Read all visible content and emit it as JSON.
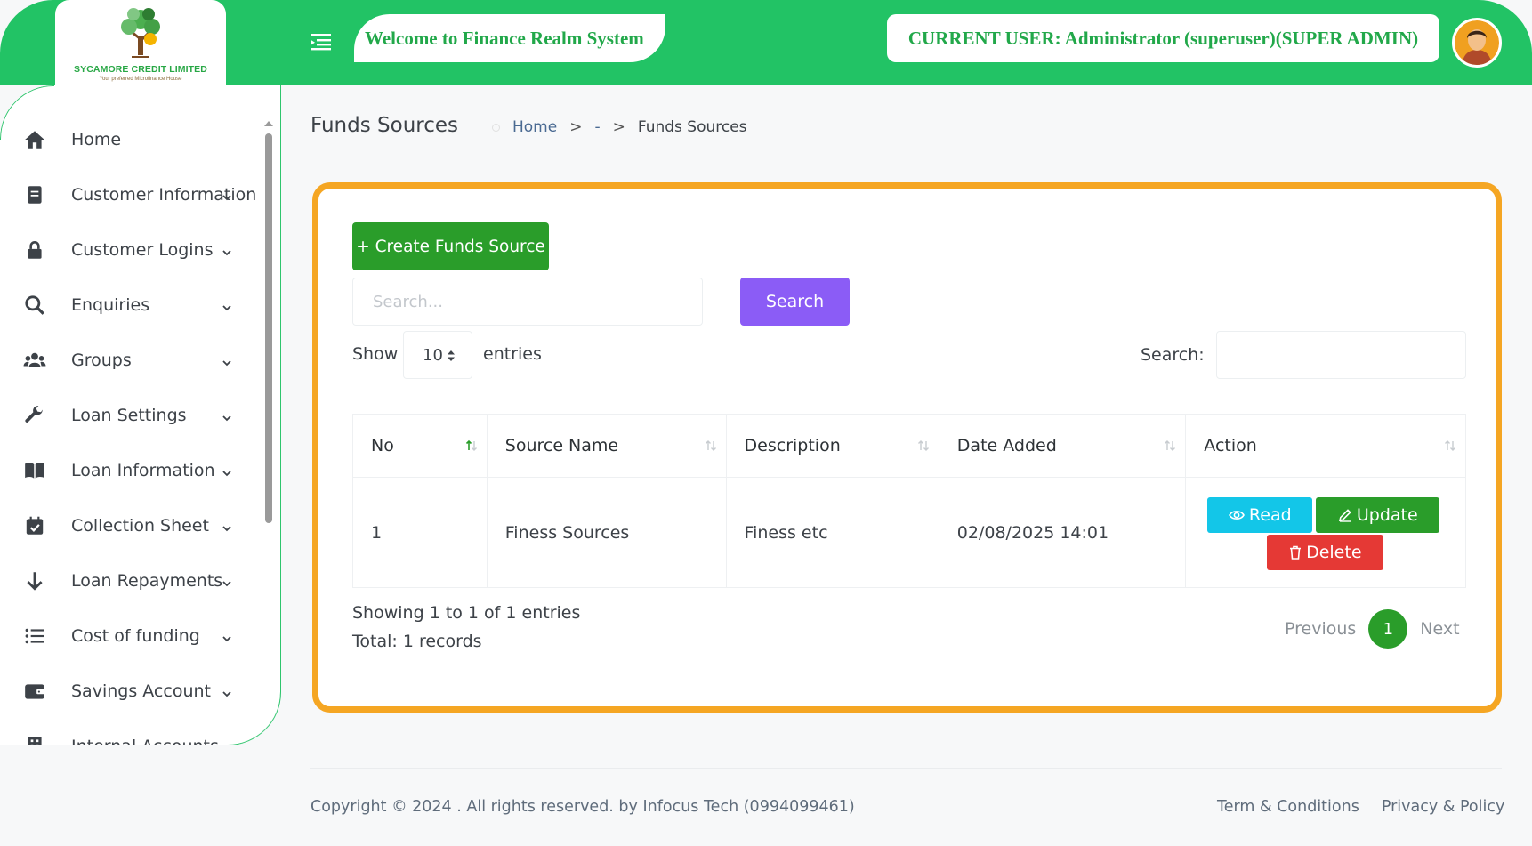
{
  "header": {
    "logo_name": "SYCAMORE CREDIT LIMITED",
    "logo_tagline": "Your preferred Microfinance House",
    "welcome": "Welcome to Finance Realm System",
    "current_user": "CURRENT USER: Administrator (superuser)(SUPER ADMIN)"
  },
  "sidebar": {
    "items": [
      {
        "label": "Home",
        "icon": "home-icon",
        "has_submenu": false
      },
      {
        "label": "Customer Information",
        "icon": "document-icon",
        "has_submenu": true
      },
      {
        "label": "Customer Logins",
        "icon": "lock-icon",
        "has_submenu": true
      },
      {
        "label": "Enquiries",
        "icon": "search-icon",
        "has_submenu": true
      },
      {
        "label": "Groups",
        "icon": "users-icon",
        "has_submenu": true
      },
      {
        "label": "Loan Settings",
        "icon": "wrench-icon",
        "has_submenu": true
      },
      {
        "label": "Loan Information",
        "icon": "book-icon",
        "has_submenu": true
      },
      {
        "label": "Collection Sheet",
        "icon": "calendar-check-icon",
        "has_submenu": true
      },
      {
        "label": "Loan Repayments",
        "icon": "arrow-down-icon",
        "has_submenu": true
      },
      {
        "label": "Cost of funding",
        "icon": "list-icon",
        "has_submenu": true
      },
      {
        "label": "Savings Account",
        "icon": "wallet-icon",
        "has_submenu": true
      },
      {
        "label": "Internal Accounts",
        "icon": "building-icon",
        "has_submenu": true
      }
    ]
  },
  "page": {
    "title": "Funds Sources",
    "breadcrumb": {
      "home": "Home",
      "middle": "-",
      "current": "Funds Sources",
      "separator": ">"
    }
  },
  "card": {
    "create_button": "+ Create Funds Source",
    "search_placeholder": "Search...",
    "search_button": "Search",
    "show_label": "Show",
    "page_length": "10",
    "entries_label": "entries",
    "filter_label": "Search:",
    "table": {
      "columns": [
        "No",
        "Source Name",
        "Description",
        "Date Added",
        "Action"
      ],
      "rows": [
        {
          "no": "1",
          "source_name": "Finess Sources",
          "description": "Finess etc",
          "date_added": "02/08/2025 14:01"
        }
      ],
      "actions": {
        "read": "Read",
        "update": "Update",
        "delete": "Delete"
      }
    },
    "info": "Showing 1 to 1 of 1 entries",
    "total": "Total: 1 records",
    "pagination": {
      "previous": "Previous",
      "current": "1",
      "next": "Next"
    }
  },
  "footer": {
    "copyright": "Copyright © 2024 . All rights reserved. by Infocus Tech (0994099461)",
    "terms": "Term & Conditions",
    "privacy": "Privacy & Policy"
  },
  "colors": {
    "brand_green": "#22c365",
    "button_green": "#2a9d2a",
    "search_purple": "#8b5cf6",
    "read_cyan": "#13c6e8",
    "delete_red": "#e53935",
    "card_border_orange": "#f5a623"
  }
}
